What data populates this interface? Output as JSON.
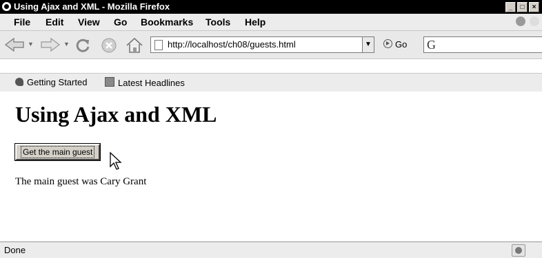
{
  "window": {
    "title": "Using Ajax and XML - Mozilla Firefox",
    "controls": {
      "minimize": "_",
      "maximize": "□",
      "close": "×"
    }
  },
  "menubar": {
    "items": [
      {
        "label": "File"
      },
      {
        "label": "Edit"
      },
      {
        "label": "View"
      },
      {
        "label": "Go"
      },
      {
        "label": "Bookmarks"
      },
      {
        "label": "Tools"
      },
      {
        "label": "Help"
      }
    ]
  },
  "navbar": {
    "url": "http://localhost/ch08/guests.html",
    "go_label": "Go",
    "search_engine_glyph": "G"
  },
  "bookmarks": {
    "items": [
      {
        "label": "Getting Started",
        "icon": "firefox-icon"
      },
      {
        "label": "Latest Headlines",
        "icon": "rss-feed-icon"
      }
    ]
  },
  "page": {
    "heading": "Using Ajax and XML",
    "button_label": "Get the main guest",
    "result_text": "The main guest was Cary Grant"
  },
  "statusbar": {
    "status": "Done"
  }
}
